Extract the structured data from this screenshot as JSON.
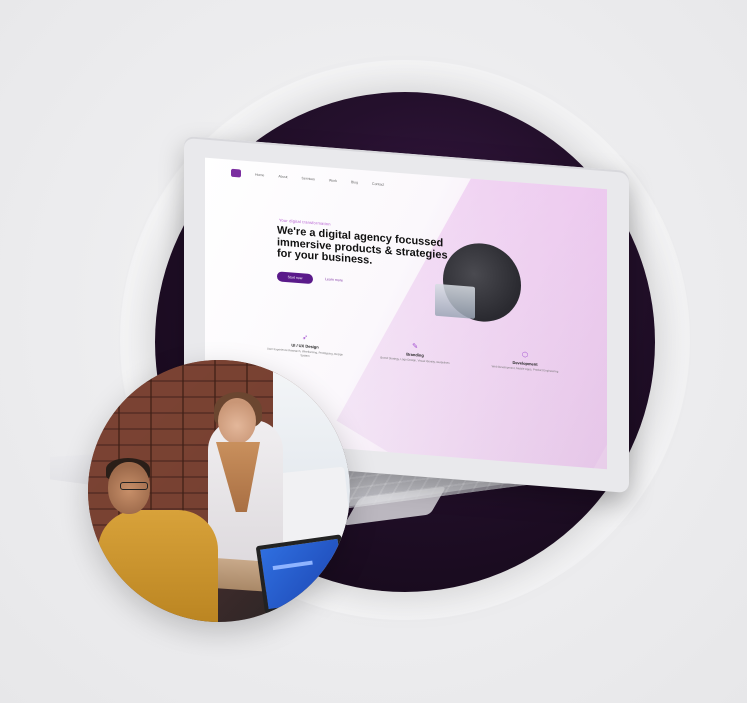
{
  "scene": {
    "description_colors": {
      "background": "#ececee",
      "dark_circle": "#24102c",
      "accent_purple": "#5a1a8a",
      "accent_pink": "#e8cde9"
    }
  },
  "laptop_screen": {
    "eyebrow": "Your digital transformation",
    "headline": "We're a digital agency focussed immersive products & strategies for your business.",
    "cta_primary": "Start now",
    "cta_secondary": "Learn more",
    "nav_items": [
      "Home",
      "About",
      "Services",
      "Work",
      "Blog",
      "Contact"
    ],
    "services": [
      {
        "icon": "cursor-icon",
        "title": "UI / UX Design",
        "desc": "User Experience Research, Wireframing, Prototyping, Design System"
      },
      {
        "icon": "pen-icon",
        "title": "Branding",
        "desc": "Brand Strategy, Logo Design, Visual Identity, Guidelines"
      },
      {
        "icon": "cube-icon",
        "title": "Development",
        "desc": "Web Development, Mobile Apps, Product Engineering"
      }
    ]
  }
}
